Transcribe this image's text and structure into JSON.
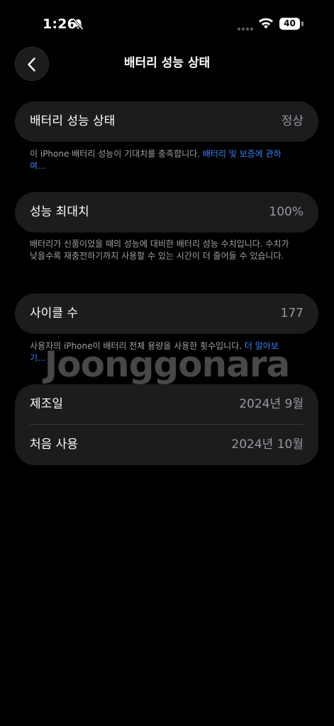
{
  "status_bar": {
    "time": "1:26",
    "battery_level": "40",
    "icons": [
      "bell-slash-icon",
      "cellular-signal-icon",
      "wifi-icon",
      "battery-icon"
    ]
  },
  "nav": {
    "title": "배터리 성능 상태",
    "back_icon": "chevron-left-icon"
  },
  "health": {
    "label": "배터리 성능 상태",
    "value": "정상",
    "footnote_text": "이 iPhone 배터리 성능이 기대치를 충족합니다. ",
    "footnote_link": "배터리 및 보증에 관하여..."
  },
  "max_capacity": {
    "label": "성능 최대치",
    "value": "100%",
    "footnote_text": "배터리가 신품이었을 때의 성능에 대비한 배터리 성능 수치입니다. 수치가 낮을수록 재충전하기까지 사용할 수 있는 시간이 더 줄어들 수 있습니다."
  },
  "cycle_count": {
    "label": "사이클 수",
    "value": "177",
    "footnote_text": "사용자의 iPhone이 배터리 전체 용량을 사용한 횟수입니다. ",
    "footnote_link": "더 알아보기..."
  },
  "dates": {
    "manufacture_label": "제조일",
    "manufacture_value": "2024년 9월",
    "first_use_label": "처음 사용",
    "first_use_value": "2024년 10월"
  },
  "watermark": "Joonggonara",
  "colors": {
    "background": "#000000",
    "card": "#1c1c1e",
    "secondary_text": "#98989d",
    "link": "#3b82f6"
  }
}
